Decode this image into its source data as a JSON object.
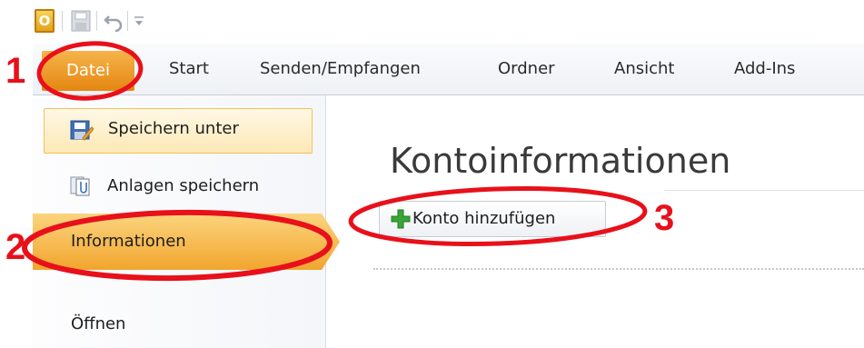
{
  "quick_access": {
    "icons": [
      "outlook-app-icon",
      "save-icon",
      "undo-icon",
      "customize-icon"
    ],
    "outlook_letter": "O"
  },
  "ribbon": {
    "tabs": [
      {
        "label": "Datei"
      },
      {
        "label": "Start"
      },
      {
        "label": "Senden/Empfangen"
      },
      {
        "label": "Ordner"
      },
      {
        "label": "Ansicht"
      },
      {
        "label": "Add-Ins"
      }
    ]
  },
  "backstage": {
    "menu": [
      {
        "label": "Speichern unter",
        "icon": "save-as-icon"
      },
      {
        "label": "Anlagen speichern",
        "icon": "attachments-icon"
      },
      {
        "label": "Informationen"
      },
      {
        "label": "Öffnen"
      }
    ]
  },
  "main": {
    "title": "Kontoinformationen",
    "add_account_label": "Konto hinzufügen"
  },
  "annotations": {
    "labels": [
      "1",
      "2",
      "3"
    ],
    "color": "#e8101a"
  },
  "colors": {
    "file_tab": "#e58612",
    "selected_item": "#f2a52e",
    "plus_icon": "#3aa537"
  }
}
